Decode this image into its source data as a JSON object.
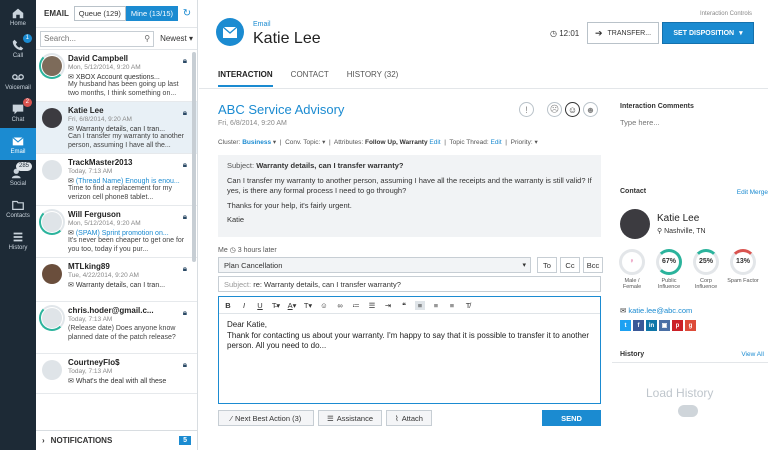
{
  "nav": {
    "items": [
      {
        "label": "Home",
        "icon": "home-icon",
        "badge": ""
      },
      {
        "label": "Call",
        "icon": "phone-icon",
        "badge": "1"
      },
      {
        "label": "Voicemail",
        "icon": "voicemail-icon",
        "badge": ""
      },
      {
        "label": "Chat",
        "icon": "chat-icon",
        "badge": "2"
      },
      {
        "label": "Email",
        "icon": "email-icon",
        "badge": ""
      },
      {
        "label": "Social",
        "icon": "social-icon",
        "badge": "285"
      },
      {
        "label": "Contacts",
        "icon": "contacts-icon",
        "badge": ""
      },
      {
        "label": "History",
        "icon": "history-icon",
        "badge": ""
      }
    ]
  },
  "list": {
    "title": "EMAIL",
    "queue_label": "Queue (129)",
    "mine_label": "Mine (13/15)",
    "search_placeholder": "Search...",
    "sort_label": "Newest",
    "items": [
      {
        "name": "David Campbell",
        "date": "Mon, 5/12/2014, 9:20 AM",
        "subject": "XBOX Account questions...",
        "preview": "My husband has been going up last two months, I think something on..."
      },
      {
        "name": "Katie Lee",
        "date": "Fri, 6/8/2014, 9:20 AM",
        "subject": "Warranty details, can I tran...",
        "preview": "Can I transfer my warranty to another person, assuming I have all the..."
      },
      {
        "name": "TrackMaster2013",
        "date": "Today, 7:13 AM",
        "subject": "(Thread Name) Enough is enou...",
        "preview": "Time to find a replacement for my verizon cell phone8 tablet..."
      },
      {
        "name": "Will Ferguson",
        "date": "Mon, 5/12/2014, 9:20 AM",
        "subject": "(SPAM) Sprint promotion on...",
        "preview": "It's never been cheaper to get one for you too, today if you pur..."
      },
      {
        "name": "MTLking89",
        "date": "Tue, 4/22/2014, 9:20 AM",
        "subject": "Warranty details, can I tran...",
        "preview": ""
      },
      {
        "name": "chris.hoder@gmail.c...",
        "date": "Today, 7:13 AM",
        "subject": "(Release date) Does anyone know planned date of the patch release?",
        "preview": ""
      },
      {
        "name": "CourtneyFlo$",
        "date": "Today, 7:13 AM",
        "subject": "What's the deal with all these",
        "preview": ""
      }
    ],
    "notifications_label": "NOTIFICATIONS",
    "notifications_count": "5"
  },
  "header": {
    "controls_label": "Interaction Controls",
    "channel": "Email",
    "name": "Katie Lee",
    "timer": "12:01",
    "transfer_label": "TRANSFER...",
    "disposition_label": "SET DISPOSITION"
  },
  "tabs": [
    {
      "label": "INTERACTION"
    },
    {
      "label": "CONTACT"
    },
    {
      "label": "HISTORY (32)"
    }
  ],
  "conversation": {
    "title": "ABC Service Advisory",
    "date": "Fri, 6/8/2014, 9:20 AM",
    "meta": {
      "cluster_label": "Cluster:",
      "cluster_value": "Business",
      "conv_label": "Conv. Topic:",
      "attr_label": "Attributes:",
      "attr_value": "Follow Up, Warranty",
      "edit": "Edit",
      "thread_label": "Topic Thread:",
      "priority_label": "Priority:"
    },
    "message": {
      "subject_label": "Subject:",
      "subject": "Warranty details, can I transfer warranty?",
      "p1": "Can I transfer my warranty to another person, assuming I have all the receipts and the warranty is still valid? If yes, is there any formal process I need to go through?",
      "p2": "Thanks for your help, it's fairly urgent.",
      "p3": "Katie"
    },
    "me_label": "Me",
    "me_time": "3 hours later"
  },
  "reply": {
    "canned": "Plan Cancellation",
    "to": "To",
    "cc": "Cc",
    "bcc": "Bcc",
    "subject_label": "Subject:",
    "subject": "re: Warranty details, can I transfer warranty?",
    "body_1": "Dear Katie,",
    "body_2": "Thank for contacting us about your warranty. I'm happy to say that it is possible to transfer it to another person. All you need to do...",
    "next_best": "Next Best Action (3)",
    "assistance": "Assistance",
    "attach": "Attach",
    "send": "SEND"
  },
  "right": {
    "comments_title": "Interaction Comments",
    "comments_placeholder": "Type here...",
    "contact_title": "Contact",
    "edit": "Edit",
    "merge": "Merge",
    "contact_name": "Katie Lee",
    "location": "Nashville, TN",
    "gauges": [
      {
        "value": "",
        "label": "Male / Female"
      },
      {
        "value": "67%",
        "label": "Public Influence"
      },
      {
        "value": "25%",
        "label": "Corp Influence"
      },
      {
        "value": "13%",
        "label": "Spam Factor"
      }
    ],
    "email": "katie.lee@abc.com",
    "history_title": "History",
    "view_all": "View All",
    "load_history": "Load History"
  }
}
